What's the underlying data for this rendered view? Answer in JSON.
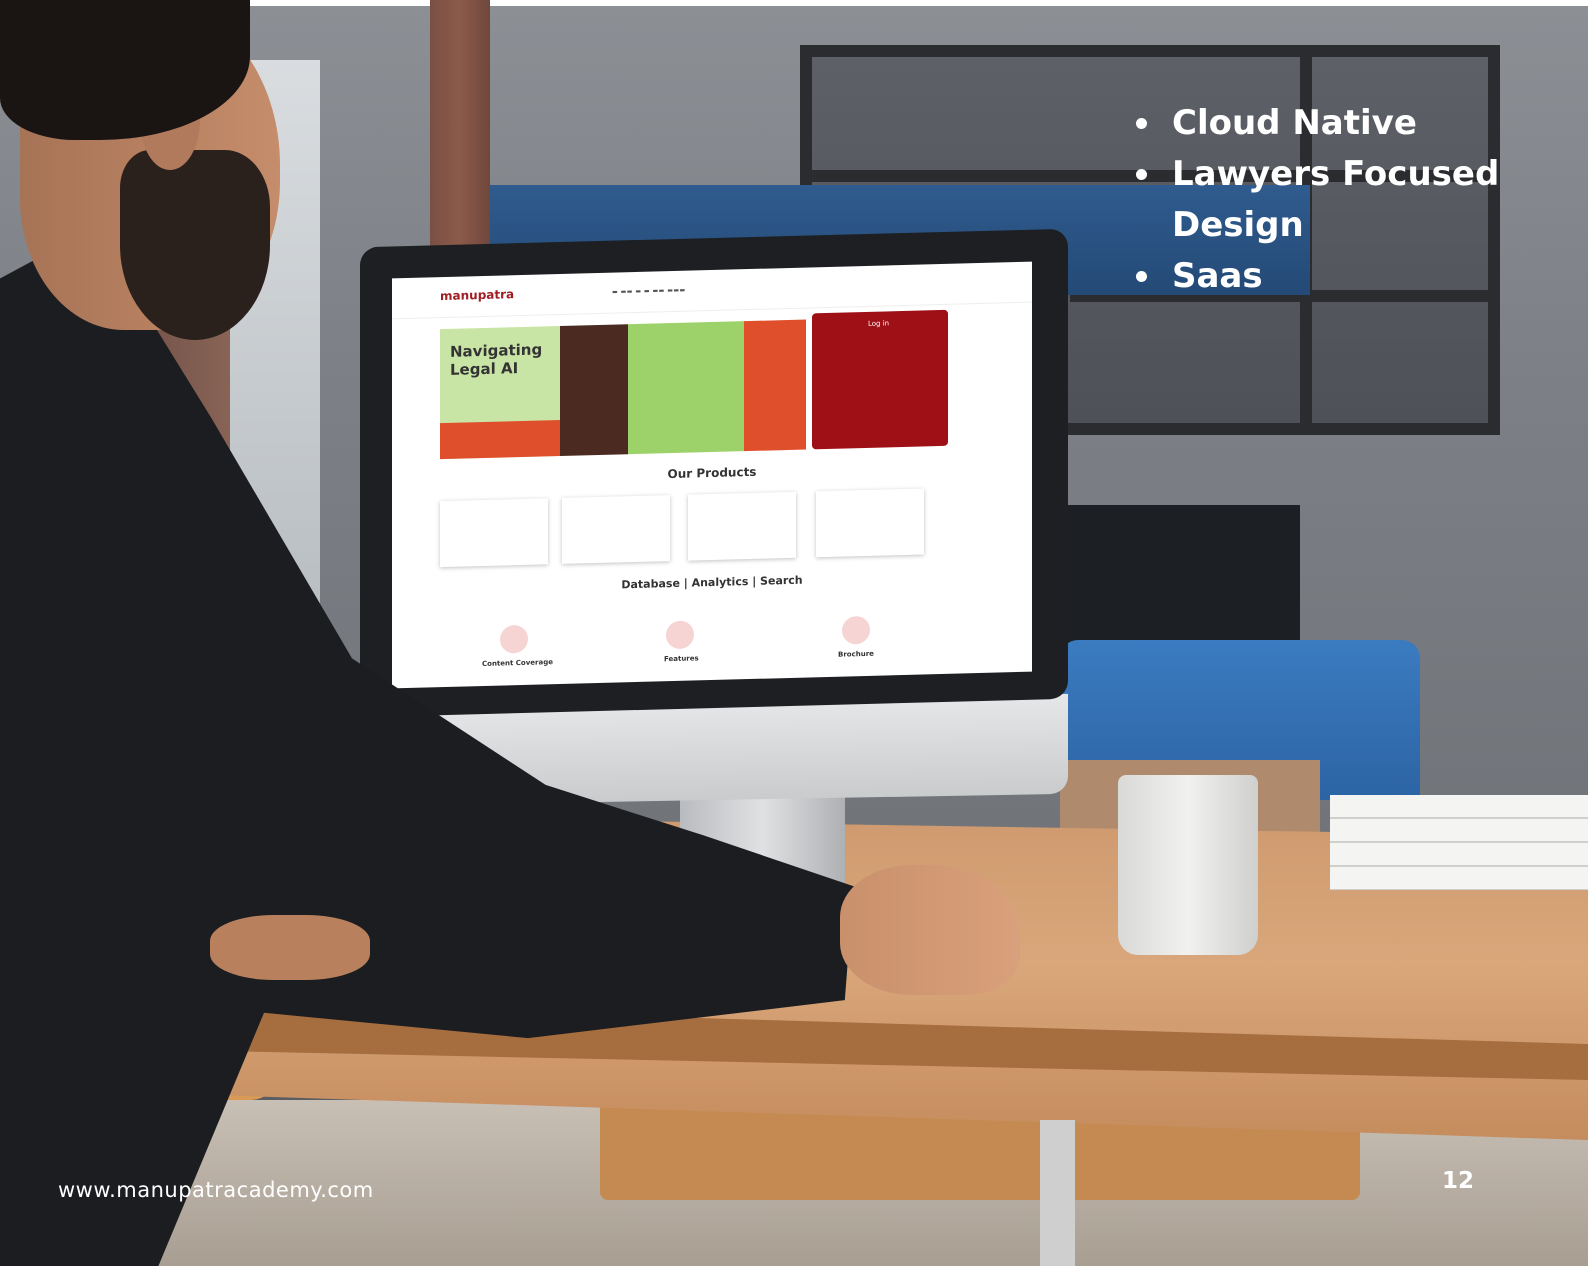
{
  "features": [
    "Cloud Native",
    "Lawyers Focused Design",
    "Saas"
  ],
  "website": "www.manupatracademy.com",
  "page_number": "12",
  "screen": {
    "logo": "manupatra",
    "hero_title": "Navigating Legal AI",
    "login_title": "Log in",
    "products_heading": "Our Products",
    "db_heading": "Database | Analytics | Search",
    "icon_labels": [
      "Content Coverage",
      "Features",
      "Brochure"
    ]
  }
}
